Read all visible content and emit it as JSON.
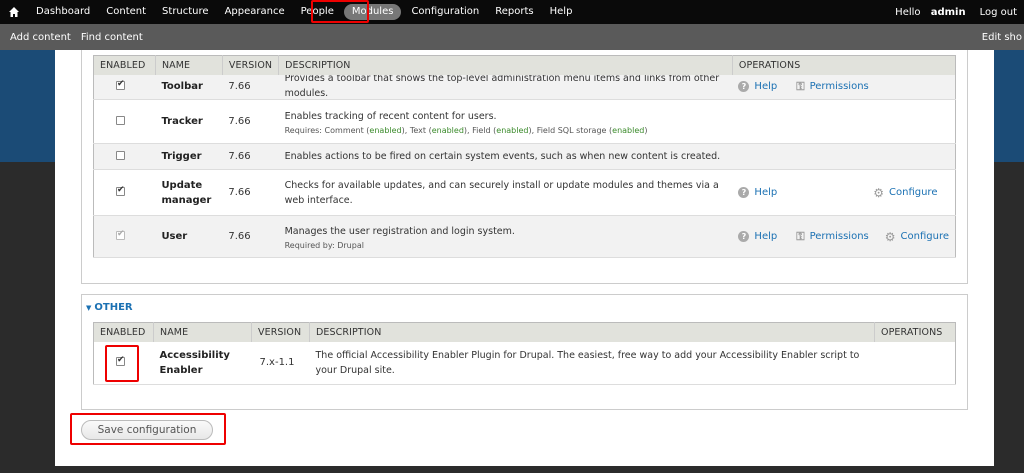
{
  "toolbar": {
    "menu": [
      "Dashboard",
      "Content",
      "Structure",
      "Appearance",
      "People",
      "Modules",
      "Configuration",
      "Reports",
      "Help"
    ],
    "active": "Modules",
    "hello_prefix": "Hello ",
    "user": "admin",
    "logout": "Log out"
  },
  "shortcuts": {
    "items": [
      "Add content",
      "Find content"
    ],
    "edit": "Edit sho"
  },
  "core_table": {
    "headers": [
      "ENABLED",
      "NAME",
      "VERSION",
      "DESCRIPTION",
      "OPERATIONS"
    ],
    "rows": [
      {
        "enabled": true,
        "disabled": false,
        "name": "Toolbar",
        "version": "7.66",
        "description": "Provides a toolbar that shows the top-level administration menu items and links from other modules.",
        "ops": [
          "Help",
          "Permissions"
        ]
      },
      {
        "enabled": false,
        "disabled": false,
        "name": "Tracker",
        "version": "7.66",
        "description": "Enables tracking of recent content for users.",
        "requires_label": "Requires: ",
        "requires": [
          {
            "name": "Comment",
            "status": "enabled"
          },
          {
            "name": "Text",
            "status": "enabled"
          },
          {
            "name": "Field",
            "status": "enabled"
          },
          {
            "name": "Field SQL storage",
            "status": "enabled"
          }
        ],
        "ops": []
      },
      {
        "enabled": false,
        "disabled": false,
        "name": "Trigger",
        "version": "7.66",
        "description": "Enables actions to be fired on certain system events, such as when new content is created.",
        "ops": []
      },
      {
        "enabled": true,
        "disabled": false,
        "name": "Update manager",
        "version": "7.66",
        "description": "Checks for available updates, and can securely install or update modules and themes via a web interface.",
        "ops": [
          "Help",
          "Configure"
        ]
      },
      {
        "enabled": true,
        "disabled": true,
        "name": "User",
        "version": "7.66",
        "description": "Manages the user registration and login system.",
        "required_by": "Required by: Drupal",
        "ops": [
          "Help",
          "Permissions",
          "Configure"
        ]
      }
    ]
  },
  "other": {
    "legend": "OTHER",
    "headers": [
      "ENABLED",
      "NAME",
      "VERSION",
      "DESCRIPTION",
      "OPERATIONS"
    ],
    "rows": [
      {
        "enabled": true,
        "name": "Accessibility Enabler",
        "version": "7.x-1.1",
        "description": "The official Accessibility Enabler Plugin for Drupal. The easiest, free way to add your Accessibility Enabler script to your Drupal site."
      }
    ]
  },
  "save_button": "Save configuration",
  "colors": {
    "link": "#1b71b3",
    "enabled": "#3a8a2a",
    "highlight": "#ee0000",
    "toolbar": "#0a0a0a"
  }
}
